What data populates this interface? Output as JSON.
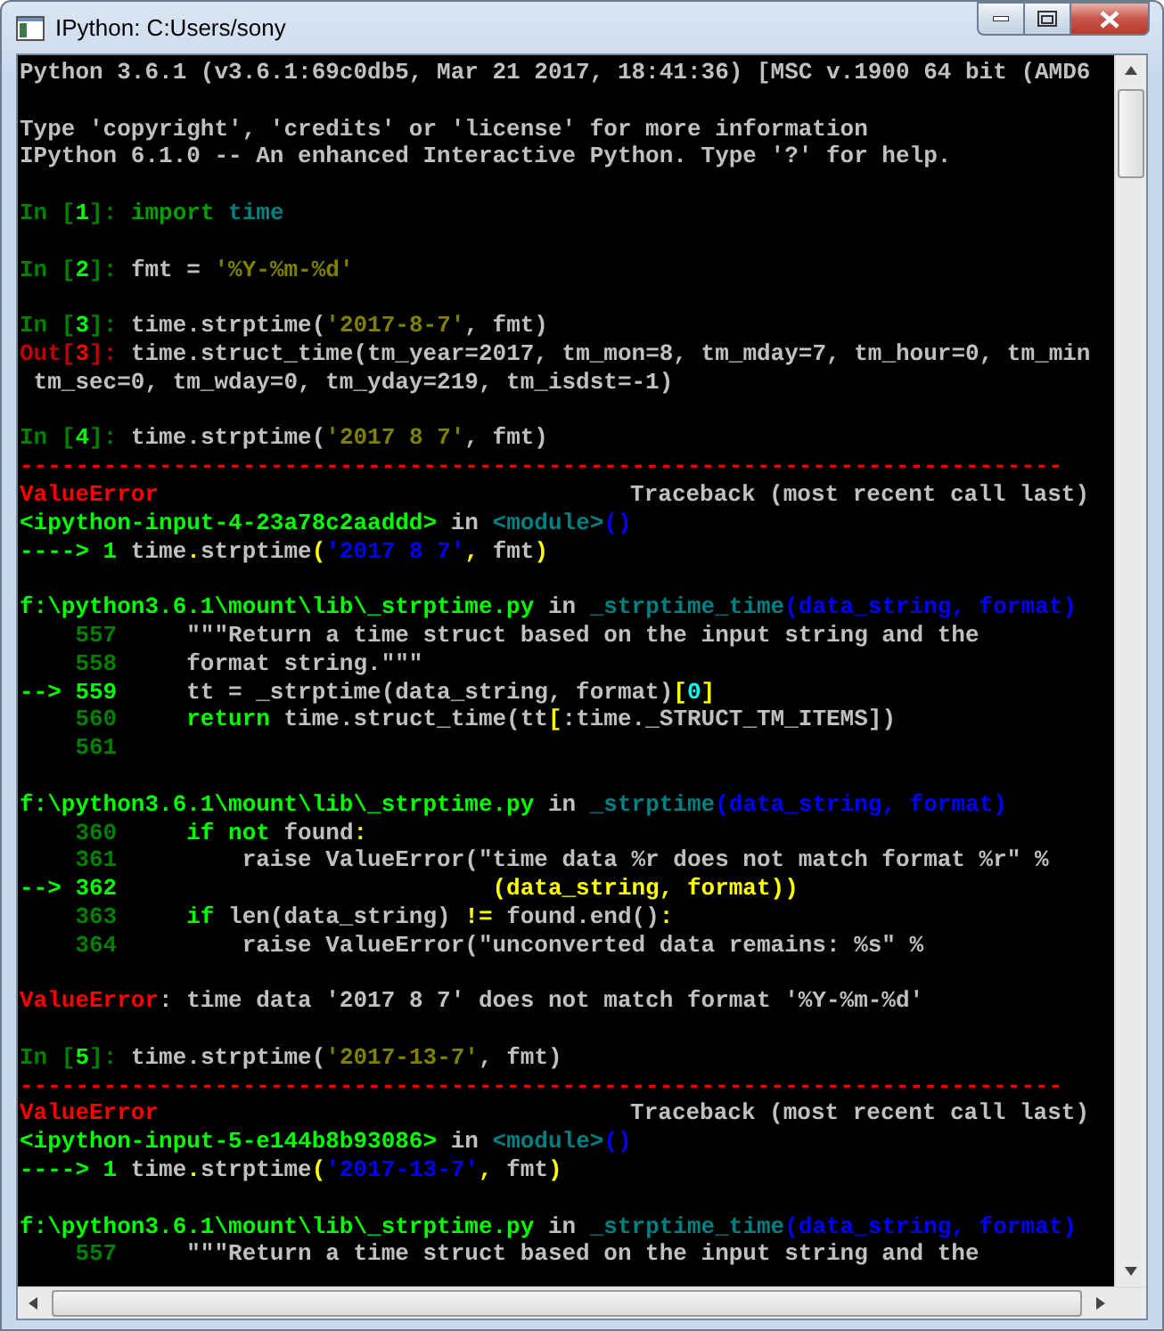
{
  "window": {
    "title": "IPython: C:Users/sony"
  },
  "console": {
    "blocks": [
      [
        {
          "segments": [
            {
              "text": "Python 3.6.1 (v3.6.1:69c0db5, Mar 21 2017, 18:41:36) [MSC v.1900 64 bit (AMD6",
              "color": "#c0c0c0"
            }
          ]
        }
      ],
      [
        {
          "segments": [
            {
              "text": "Type 'copyright', 'credits' or 'license' for more information",
              "color": "#c0c0c0"
            }
          ]
        },
        {
          "segments": [
            {
              "text": "IPython 6.1.0 -- An enhanced Interactive Python. Type '?' for help.",
              "color": "#c0c0c0"
            }
          ]
        }
      ],
      [
        {
          "segments": [
            {
              "text": "In [",
              "color": "#008000"
            },
            {
              "text": "1",
              "color": "#00ff00"
            },
            {
              "text": "]: ",
              "color": "#008000"
            },
            {
              "text": "import ",
              "color": "#00a000"
            },
            {
              "text": "time",
              "color": "#008080"
            }
          ]
        }
      ],
      [
        {
          "segments": [
            {
              "text": "In [",
              "color": "#008000"
            },
            {
              "text": "2",
              "color": "#00ff00"
            },
            {
              "text": "]: ",
              "color": "#008000"
            },
            {
              "text": "fmt = ",
              "color": "#c0c0c0"
            },
            {
              "text": "'%Y-%m-%d'",
              "color": "#808000"
            }
          ]
        }
      ],
      [
        {
          "segments": [
            {
              "text": "In [",
              "color": "#008000"
            },
            {
              "text": "3",
              "color": "#00ff00"
            },
            {
              "text": "]: ",
              "color": "#008000"
            },
            {
              "text": "time.strptime(",
              "color": "#c0c0c0"
            },
            {
              "text": "'2017-8-7'",
              "color": "#808000"
            },
            {
              "text": ", fmt)",
              "color": "#c0c0c0"
            }
          ]
        },
        {
          "segments": [
            {
              "text": "Out[",
              "color": "#c00000"
            },
            {
              "text": "3",
              "color": "#ff0000"
            },
            {
              "text": "]: ",
              "color": "#c00000"
            },
            {
              "text": "time.struct_time(tm_year=2017, tm_mon=8, tm_mday=7, tm_hour=0, tm_min",
              "color": "#c0c0c0"
            }
          ]
        },
        {
          "segments": [
            {
              "text": " tm_sec=0, tm_wday=0, tm_yday=219, tm_isdst=-1)",
              "color": "#c0c0c0"
            }
          ]
        }
      ],
      [
        {
          "segments": [
            {
              "text": "In [",
              "color": "#008000"
            },
            {
              "text": "4",
              "color": "#00ff00"
            },
            {
              "text": "]: ",
              "color": "#008000"
            },
            {
              "text": "time.strptime(",
              "color": "#c0c0c0"
            },
            {
              "text": "'2017 8 7'",
              "color": "#808000"
            },
            {
              "text": ", fmt)",
              "color": "#c0c0c0"
            }
          ]
        },
        {
          "segments": [
            {
              "text": "---------------------------------------------------------------------------",
              "color": "#ff0000"
            }
          ]
        },
        {
          "kind": "split",
          "segments": [
            {
              "text": "ValueError",
              "color": "#ff0000"
            },
            {
              "text": "Traceback (most recent call last)",
              "color": "#c0c0c0"
            }
          ]
        },
        {
          "segments": [
            {
              "text": "<ipython-input-4-23a78c2aaddd>",
              "color": "#00ff00"
            },
            {
              "text": " in ",
              "color": "#c0c0c0"
            },
            {
              "text": "<module>",
              "color": "#008080"
            },
            {
              "text": "()",
              "color": "#0000ff"
            }
          ]
        },
        {
          "segments": [
            {
              "text": "----> 1 ",
              "color": "#00ff00"
            },
            {
              "text": "time",
              "color": "#c0c0c0"
            },
            {
              "text": ".",
              "color": "#ffff00"
            },
            {
              "text": "strptime",
              "color": "#c0c0c0"
            },
            {
              "text": "(",
              "color": "#ffff00"
            },
            {
              "text": "'2017 8 7'",
              "color": "#0000ff"
            },
            {
              "text": ",",
              "color": "#ffff00"
            },
            {
              "text": " fmt",
              "color": "#c0c0c0"
            },
            {
              "text": ")",
              "color": "#ffff00"
            }
          ]
        }
      ],
      [
        {
          "segments": [
            {
              "text": "f:\\python3.6.1\\mount\\lib\\_strptime.py",
              "color": "#00ff00"
            },
            {
              "text": " in ",
              "color": "#c0c0c0"
            },
            {
              "text": "_strptime_time",
              "color": "#008080"
            },
            {
              "text": "(data_string, format)",
              "color": "#0000ff"
            }
          ]
        },
        {
          "segments": [
            {
              "text": "    557",
              "color": "#008000"
            },
            {
              "text": "     \"\"\"Return a time struct based on the input string and the",
              "color": "#c0c0c0"
            }
          ]
        },
        {
          "segments": [
            {
              "text": "    558",
              "color": "#008000"
            },
            {
              "text": "     format string.\"\"\"",
              "color": "#c0c0c0"
            }
          ]
        },
        {
          "segments": [
            {
              "text": "--> 559",
              "color": "#00ff00"
            },
            {
              "text": "     tt = _strptime(data_string, format)",
              "color": "#c0c0c0"
            },
            {
              "text": "[",
              "color": "#ffff00"
            },
            {
              "text": "0",
              "color": "#00ffff"
            },
            {
              "text": "]",
              "color": "#ffff00"
            }
          ]
        },
        {
          "segments": [
            {
              "text": "    560",
              "color": "#008000"
            },
            {
              "text": "     return",
              "color": "#00ff00"
            },
            {
              "text": " time.struct_time(tt",
              "color": "#c0c0c0"
            },
            {
              "text": "[",
              "color": "#ffff00"
            },
            {
              "text": ":time._STRUCT_TM_ITEMS])",
              "color": "#c0c0c0"
            }
          ]
        },
        {
          "segments": [
            {
              "text": "    561",
              "color": "#008000"
            }
          ]
        }
      ],
      [
        {
          "segments": [
            {
              "text": "f:\\python3.6.1\\mount\\lib\\_strptime.py",
              "color": "#00ff00"
            },
            {
              "text": " in ",
              "color": "#c0c0c0"
            },
            {
              "text": "_strptime",
              "color": "#008080"
            },
            {
              "text": "(data_string, format)",
              "color": "#0000ff"
            }
          ]
        },
        {
          "segments": [
            {
              "text": "    360",
              "color": "#008000"
            },
            {
              "text": "     if not",
              "color": "#00ff00"
            },
            {
              "text": " found",
              "color": "#c0c0c0"
            },
            {
              "text": ":",
              "color": "#ffff00"
            }
          ]
        },
        {
          "segments": [
            {
              "text": "    361",
              "color": "#008000"
            },
            {
              "text": "         raise ValueError(\"time data %r does not match format %r\" %",
              "color": "#c0c0c0"
            }
          ]
        },
        {
          "segments": [
            {
              "text": "--> 362",
              "color": "#00ff00"
            },
            {
              "text": "                           (data_string, format))",
              "color": "#ffff00"
            }
          ]
        },
        {
          "segments": [
            {
              "text": "    363",
              "color": "#008000"
            },
            {
              "text": "     if",
              "color": "#00ff00"
            },
            {
              "text": " len(data_string) ",
              "color": "#c0c0c0"
            },
            {
              "text": "!=",
              "color": "#ffff00"
            },
            {
              "text": " found.end()",
              "color": "#c0c0c0"
            },
            {
              "text": ":",
              "color": "#ffff00"
            }
          ]
        },
        {
          "segments": [
            {
              "text": "    364",
              "color": "#008000"
            },
            {
              "text": "         raise ValueError(\"unconverted data remains: %s\" %",
              "color": "#c0c0c0"
            }
          ]
        }
      ],
      [
        {
          "segments": [
            {
              "text": "ValueError",
              "color": "#ff0000"
            },
            {
              "text": ": time data '2017 8 7' does not match format '%Y-%m-%d'",
              "color": "#c0c0c0"
            }
          ]
        }
      ],
      [
        {
          "segments": [
            {
              "text": "In [",
              "color": "#008000"
            },
            {
              "text": "5",
              "color": "#00ff00"
            },
            {
              "text": "]: ",
              "color": "#008000"
            },
            {
              "text": "time.strptime(",
              "color": "#c0c0c0"
            },
            {
              "text": "'2017-13-7'",
              "color": "#808000"
            },
            {
              "text": ", fmt)",
              "color": "#c0c0c0"
            }
          ]
        },
        {
          "segments": [
            {
              "text": "---------------------------------------------------------------------------",
              "color": "#ff0000"
            }
          ]
        },
        {
          "kind": "split",
          "segments": [
            {
              "text": "ValueError",
              "color": "#ff0000"
            },
            {
              "text": "Traceback (most recent call last)",
              "color": "#c0c0c0"
            }
          ]
        },
        {
          "segments": [
            {
              "text": "<ipython-input-5-e144b8b93086>",
              "color": "#00ff00"
            },
            {
              "text": " in ",
              "color": "#c0c0c0"
            },
            {
              "text": "<module>",
              "color": "#008080"
            },
            {
              "text": "()",
              "color": "#0000ff"
            }
          ]
        },
        {
          "segments": [
            {
              "text": "----> 1 ",
              "color": "#00ff00"
            },
            {
              "text": "time",
              "color": "#c0c0c0"
            },
            {
              "text": ".",
              "color": "#ffff00"
            },
            {
              "text": "strptime",
              "color": "#c0c0c0"
            },
            {
              "text": "(",
              "color": "#ffff00"
            },
            {
              "text": "'2017-13-7'",
              "color": "#0000ff"
            },
            {
              "text": ",",
              "color": "#ffff00"
            },
            {
              "text": " fmt",
              "color": "#c0c0c0"
            },
            {
              "text": ")",
              "color": "#ffff00"
            }
          ]
        }
      ],
      [
        {
          "segments": [
            {
              "text": "f:\\python3.6.1\\mount\\lib\\_strptime.py",
              "color": "#00ff00"
            },
            {
              "text": " in ",
              "color": "#c0c0c0"
            },
            {
              "text": "_strptime_time",
              "color": "#008080"
            },
            {
              "text": "(data_string, format)",
              "color": "#0000ff"
            }
          ]
        },
        {
          "segments": [
            {
              "text": "    557",
              "color": "#008000"
            },
            {
              "text": "     \"\"\"Return a time struct based on the input string and the",
              "color": "#c0c0c0"
            }
          ]
        }
      ]
    ]
  }
}
